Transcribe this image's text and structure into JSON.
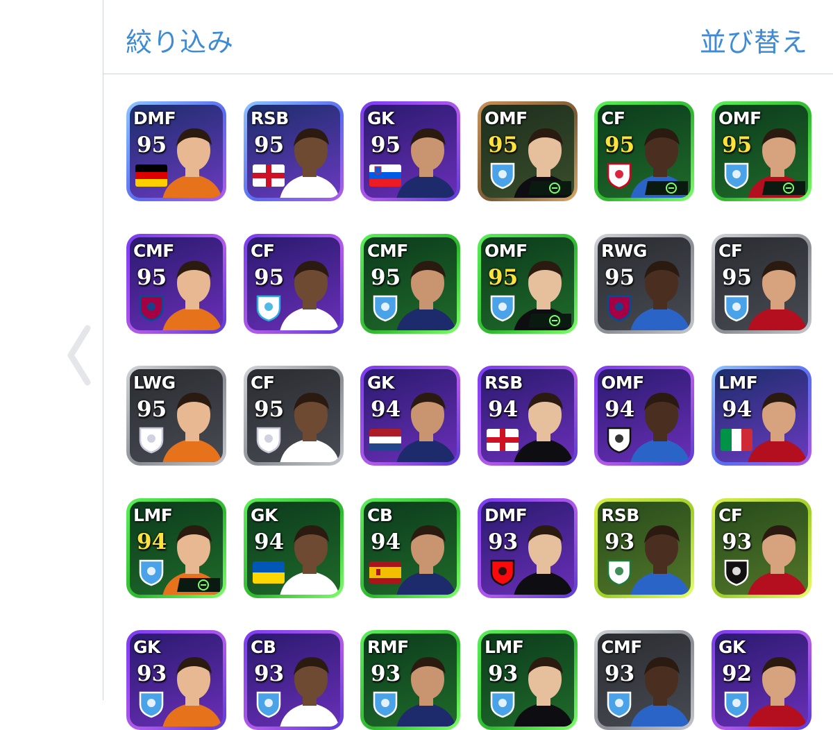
{
  "header": {
    "filter_label": "絞り込み",
    "sort_label": "並び替え"
  },
  "icons": {
    "back": "chevron-left-icon",
    "card_marker": "efootball-e-icon"
  },
  "colors": {
    "accent": "#3d8bd6",
    "divider": "#cfd3d8",
    "rating_gold": "#ffe23a"
  },
  "players": [
    {
      "pos": "DMF",
      "rating": "95",
      "gold": false,
      "frame": "blue",
      "badge": "germany-flag",
      "e": false
    },
    {
      "pos": "RSB",
      "rating": "95",
      "gold": false,
      "frame": "blue",
      "badge": "england-flag",
      "e": false
    },
    {
      "pos": "GK",
      "rating": "95",
      "gold": false,
      "frame": "purple",
      "badge": "slovenia-flag",
      "e": false
    },
    {
      "pos": "OMF",
      "rating": "95",
      "gold": true,
      "frame": "bronze",
      "badge": "club-crest",
      "e": true
    },
    {
      "pos": "CF",
      "rating": "95",
      "gold": true,
      "frame": "green",
      "badge": "lyon-crest",
      "e": true
    },
    {
      "pos": "OMF",
      "rating": "95",
      "gold": true,
      "frame": "green",
      "badge": "club-crest",
      "e": true
    },
    {
      "pos": "CMF",
      "rating": "95",
      "gold": false,
      "frame": "purple",
      "badge": "barcelona-crest",
      "e": false
    },
    {
      "pos": "CF",
      "rating": "95",
      "gold": false,
      "frame": "purple",
      "badge": "marseille-crest",
      "e": false
    },
    {
      "pos": "CMF",
      "rating": "95",
      "gold": false,
      "frame": "green",
      "badge": "club-crest",
      "e": false
    },
    {
      "pos": "OMF",
      "rating": "95",
      "gold": true,
      "frame": "green",
      "badge": "club-crest",
      "e": true
    },
    {
      "pos": "RWG",
      "rating": "95",
      "gold": false,
      "frame": "silver",
      "badge": "barcelona-crest",
      "e": false
    },
    {
      "pos": "CF",
      "rating": "95",
      "gold": false,
      "frame": "silver",
      "badge": "club-crest",
      "e": false
    },
    {
      "pos": "LWG",
      "rating": "95",
      "gold": false,
      "frame": "silver",
      "badge": "madrid-crest",
      "e": false
    },
    {
      "pos": "CF",
      "rating": "95",
      "gold": false,
      "frame": "silver",
      "badge": "madrid-crest",
      "e": false
    },
    {
      "pos": "GK",
      "rating": "94",
      "gold": false,
      "frame": "purple",
      "badge": "netherlands-flag",
      "e": false
    },
    {
      "pos": "RSB",
      "rating": "94",
      "gold": false,
      "frame": "purple",
      "badge": "england-flag",
      "e": false
    },
    {
      "pos": "OMF",
      "rating": "94",
      "gold": false,
      "frame": "purple",
      "badge": "udinese-crest",
      "e": false
    },
    {
      "pos": "LMF",
      "rating": "94",
      "gold": false,
      "frame": "blue",
      "badge": "italy-flag",
      "e": false
    },
    {
      "pos": "LMF",
      "rating": "94",
      "gold": true,
      "frame": "green",
      "badge": "club-crest",
      "e": true
    },
    {
      "pos": "GK",
      "rating": "94",
      "gold": false,
      "frame": "green",
      "badge": "ukraine-flag",
      "e": false
    },
    {
      "pos": "CB",
      "rating": "94",
      "gold": false,
      "frame": "green",
      "badge": "spain-flag",
      "e": false
    },
    {
      "pos": "DMF",
      "rating": "93",
      "gold": false,
      "frame": "purple",
      "badge": "milan-crest",
      "e": false
    },
    {
      "pos": "RSB",
      "rating": "93",
      "gold": false,
      "frame": "yellowgreen",
      "badge": "palmeiras-crest",
      "e": false
    },
    {
      "pos": "CF",
      "rating": "93",
      "gold": false,
      "frame": "yellowgreen",
      "badge": "botafogo-crest",
      "e": false
    },
    {
      "pos": "GK",
      "rating": "93",
      "gold": false,
      "frame": "purple",
      "badge": "club-crest",
      "e": false
    },
    {
      "pos": "CB",
      "rating": "93",
      "gold": false,
      "frame": "purple",
      "badge": "club-crest",
      "e": false
    },
    {
      "pos": "RMF",
      "rating": "93",
      "gold": false,
      "frame": "green",
      "badge": "club-crest",
      "e": false
    },
    {
      "pos": "LMF",
      "rating": "93",
      "gold": false,
      "frame": "green",
      "badge": "club-crest",
      "e": false
    },
    {
      "pos": "CMF",
      "rating": "93",
      "gold": false,
      "frame": "silver",
      "badge": "club-crest",
      "e": false
    },
    {
      "pos": "GK",
      "rating": "92",
      "gold": false,
      "frame": "purple",
      "badge": "club-crest",
      "e": false
    }
  ]
}
